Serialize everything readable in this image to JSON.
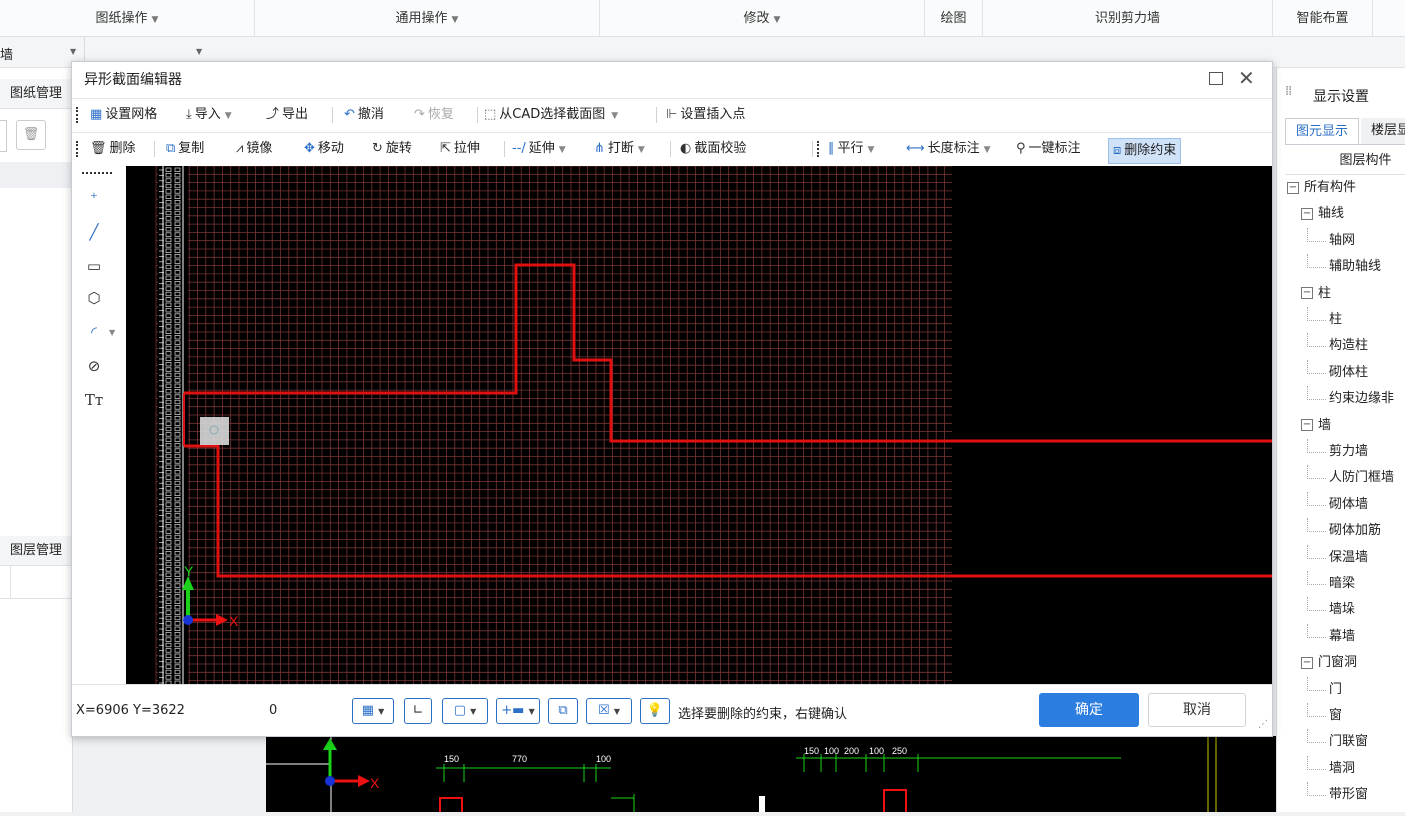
{
  "ribbon": {
    "groups": [
      {
        "label": "图纸操作",
        "dropdown": true
      },
      {
        "label": "通用操作",
        "dropdown": true
      },
      {
        "label": "修改",
        "dropdown": true
      },
      {
        "label": "绘图",
        "dropdown": false
      },
      {
        "label": "识别剪力墙",
        "dropdown": false
      },
      {
        "label": "智能布置",
        "dropdown": false
      }
    ],
    "row2_left_fragment": "墙"
  },
  "left_panel": {
    "drawing_manager": "图纸管理",
    "layer_manager": "图层管理"
  },
  "right_panel": {
    "title": "显示设置",
    "tabs": [
      "图元显示",
      "楼层显示"
    ],
    "column_header": "图层构件",
    "tree": [
      {
        "label": "所有构件",
        "level": 0,
        "toggle": "−"
      },
      {
        "label": "轴线",
        "level": 1,
        "toggle": "−"
      },
      {
        "label": "轴网",
        "level": 2
      },
      {
        "label": "辅助轴线",
        "level": 2
      },
      {
        "label": "柱",
        "level": 1,
        "toggle": "−"
      },
      {
        "label": "柱",
        "level": 2
      },
      {
        "label": "构造柱",
        "level": 2
      },
      {
        "label": "砌体柱",
        "level": 2
      },
      {
        "label": "约束边缘非",
        "level": 2
      },
      {
        "label": "墙",
        "level": 1,
        "toggle": "−"
      },
      {
        "label": "剪力墙",
        "level": 2
      },
      {
        "label": "人防门框墙",
        "level": 2
      },
      {
        "label": "砌体墙",
        "level": 2
      },
      {
        "label": "砌体加筋",
        "level": 2
      },
      {
        "label": "保温墙",
        "level": 2
      },
      {
        "label": "暗梁",
        "level": 2
      },
      {
        "label": "墙垛",
        "level": 2
      },
      {
        "label": "幕墙",
        "level": 2
      },
      {
        "label": "门窗洞",
        "level": 1,
        "toggle": "−"
      },
      {
        "label": "门",
        "level": 2
      },
      {
        "label": "窗",
        "level": 2
      },
      {
        "label": "门联窗",
        "level": 2
      },
      {
        "label": "墙洞",
        "level": 2
      },
      {
        "label": "带形窗",
        "level": 2
      }
    ]
  },
  "dialog": {
    "title": "异形截面编辑器",
    "toolbar1": {
      "set_grid": "设置网格",
      "import": "导入",
      "export": "导出",
      "undo": "撤消",
      "redo": "恢复",
      "from_cad": "从CAD选择截面图",
      "set_insert_point": "设置插入点"
    },
    "toolbar2": {
      "delete": "删除",
      "copy": "复制",
      "mirror": "镜像",
      "move": "移动",
      "rotate": "旋转",
      "stretch": "拉伸",
      "extend": "延伸",
      "break": "打断",
      "section_check": "截面校验",
      "parallel": "平行",
      "length_dim": "长度标注",
      "one_key_dim": "一键标注",
      "delete_constraint": "删除约束"
    },
    "axis": {
      "x": "X",
      "y": "Y"
    },
    "status": {
      "coords": "X=6906 Y=3622",
      "value": "0",
      "hint": "选择要删除的约束，右键确认"
    },
    "ok": "确定",
    "cancel": "取消"
  },
  "background_drawing": {
    "dims_left": [
      "150",
      "770",
      "100"
    ],
    "dims_right": [
      "150",
      "100",
      "200",
      "100",
      "250"
    ]
  },
  "colors": {
    "accent": "#2b7de0",
    "grid_line": "#7a3434",
    "section_outline": "#e01010",
    "canvas_bg": "#000000"
  }
}
